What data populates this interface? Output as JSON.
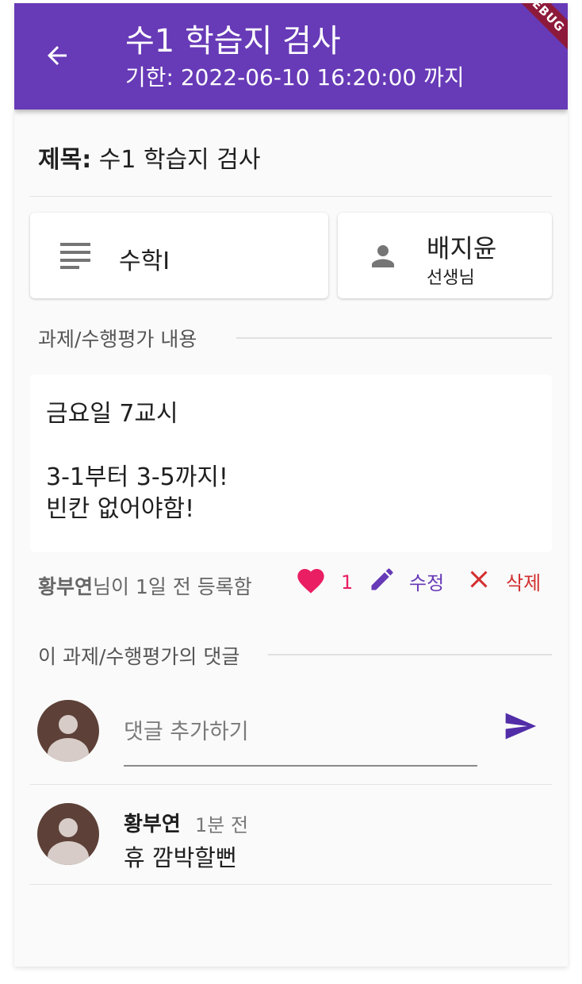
{
  "appbar": {
    "title": "수1 학습지 검사",
    "subtitle": "기한: 2022-06-10 16:20:00 까지",
    "debug_banner": "DEBUG",
    "color": "#673ab7"
  },
  "subject": {
    "label": "제목:",
    "value": "수1 학습지 검사"
  },
  "course": {
    "name": "수학I",
    "icon": "subject-lines-icon"
  },
  "teacher": {
    "name": "배지윤",
    "role": "선생님",
    "icon": "person-icon"
  },
  "content_section": {
    "label": "과제/수행평가 내용",
    "lines": [
      "금요일 7교시",
      "",
      "3-1부터 3-5까지!",
      "빈칸 없어야함!"
    ]
  },
  "meta": {
    "author": "황부연",
    "suffix": "님이 1일 전 등록함",
    "like_count": "1",
    "edit_label": "수정",
    "delete_label": "삭제",
    "like_color": "#e91e63",
    "edit_color": "#673ab7",
    "delete_color": "#d32f2f"
  },
  "comments_section": {
    "label": "이 과제/수행평가의 댓글",
    "input_placeholder": "댓글 추가하기",
    "comments": [
      {
        "author": "황부연",
        "time": "1분 전",
        "text": "휴 깜박할뻔"
      }
    ]
  }
}
